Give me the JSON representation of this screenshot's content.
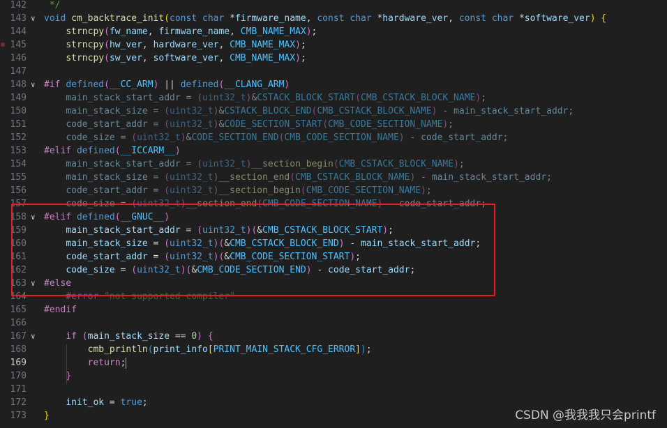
{
  "editor": {
    "lines": [
      {
        "num": "142",
        "fold": "",
        "segments": [
          [
            "cm",
            " */"
          ]
        ]
      },
      {
        "num": "143",
        "fold": "∨",
        "segments": [
          [
            "kw",
            "void "
          ],
          [
            "fn",
            "cm_backtrace_init"
          ],
          [
            "br1",
            "("
          ],
          [
            "kw",
            "const char "
          ],
          [
            "op",
            "*"
          ],
          [
            "var",
            "firmware_name"
          ],
          [
            "op",
            ", "
          ],
          [
            "kw",
            "const char "
          ],
          [
            "op",
            "*"
          ],
          [
            "var",
            "hardware_ver"
          ],
          [
            "op",
            ", "
          ],
          [
            "kw",
            "const char "
          ],
          [
            "op",
            "*"
          ],
          [
            "var",
            "software_ver"
          ],
          [
            "br1",
            ")"
          ],
          [
            "op",
            " "
          ],
          [
            "br1",
            "{"
          ]
        ]
      },
      {
        "num": "144",
        "fold": "",
        "segments": [
          [
            "op",
            "    "
          ],
          [
            "fn",
            "strncpy"
          ],
          [
            "br2",
            "("
          ],
          [
            "var",
            "fw_name"
          ],
          [
            "op",
            ", "
          ],
          [
            "var",
            "firmware_name"
          ],
          [
            "op",
            ", "
          ],
          [
            "mac",
            "CMB_NAME_MAX"
          ],
          [
            "br2",
            ")"
          ],
          [
            "op",
            ";"
          ]
        ]
      },
      {
        "num": "145",
        "fold": "",
        "breakpoint": true,
        "segments": [
          [
            "op",
            "    "
          ],
          [
            "fn",
            "strncpy"
          ],
          [
            "br2",
            "("
          ],
          [
            "var",
            "hw_ver"
          ],
          [
            "op",
            ", "
          ],
          [
            "var",
            "hardware_ver"
          ],
          [
            "op",
            ", "
          ],
          [
            "mac",
            "CMB_NAME_MAX"
          ],
          [
            "br2",
            ")"
          ],
          [
            "op",
            ";"
          ]
        ]
      },
      {
        "num": "146",
        "fold": "",
        "segments": [
          [
            "op",
            "    "
          ],
          [
            "fn",
            "strncpy"
          ],
          [
            "br2",
            "("
          ],
          [
            "var",
            "sw_ver"
          ],
          [
            "op",
            ", "
          ],
          [
            "var",
            "software_ver"
          ],
          [
            "op",
            ", "
          ],
          [
            "mac",
            "CMB_NAME_MAX"
          ],
          [
            "br2",
            ")"
          ],
          [
            "op",
            ";"
          ]
        ]
      },
      {
        "num": "147",
        "fold": "",
        "segments": []
      },
      {
        "num": "148",
        "fold": "∨",
        "segments": [
          [
            "pp",
            "#if "
          ],
          [
            "kw",
            "defined"
          ],
          [
            "br2",
            "("
          ],
          [
            "mac",
            "__CC_ARM"
          ],
          [
            "br2",
            ")"
          ],
          [
            "op",
            " || "
          ],
          [
            "kw",
            "defined"
          ],
          [
            "br2",
            "("
          ],
          [
            "mac",
            "__CLANG_ARM"
          ],
          [
            "br2",
            ")"
          ]
        ]
      },
      {
        "num": "149",
        "fold": "",
        "dim": true,
        "segments": [
          [
            "op",
            "    "
          ],
          [
            "var",
            "main_stack_start_addr"
          ],
          [
            "op",
            " = "
          ],
          [
            "br2",
            "("
          ],
          [
            "kw",
            "uint32_t"
          ],
          [
            "br2",
            ")"
          ],
          [
            "op",
            "&"
          ],
          [
            "mac",
            "CSTACK_BLOCK_START"
          ],
          [
            "br2",
            "("
          ],
          [
            "mac",
            "CMB_CSTACK_BLOCK_NAME"
          ],
          [
            "br2",
            ")"
          ],
          [
            "op",
            ";"
          ]
        ]
      },
      {
        "num": "150",
        "fold": "",
        "dim": true,
        "segments": [
          [
            "op",
            "    "
          ],
          [
            "var",
            "main_stack_size"
          ],
          [
            "op",
            " = "
          ],
          [
            "br2",
            "("
          ],
          [
            "kw",
            "uint32_t"
          ],
          [
            "br2",
            ")"
          ],
          [
            "op",
            "&"
          ],
          [
            "mac",
            "CSTACK_BLOCK_END"
          ],
          [
            "br2",
            "("
          ],
          [
            "mac",
            "CMB_CSTACK_BLOCK_NAME"
          ],
          [
            "br2",
            ")"
          ],
          [
            "op",
            " - "
          ],
          [
            "var",
            "main_stack_start_addr"
          ],
          [
            "op",
            ";"
          ]
        ]
      },
      {
        "num": "151",
        "fold": "",
        "dim": true,
        "segments": [
          [
            "op",
            "    "
          ],
          [
            "var",
            "code_start_addr"
          ],
          [
            "op",
            " = "
          ],
          [
            "br2",
            "("
          ],
          [
            "kw",
            "uint32_t"
          ],
          [
            "br2",
            ")"
          ],
          [
            "op",
            "&"
          ],
          [
            "mac",
            "CODE_SECTION_START"
          ],
          [
            "br2",
            "("
          ],
          [
            "mac",
            "CMB_CODE_SECTION_NAME"
          ],
          [
            "br2",
            ")"
          ],
          [
            "op",
            ";"
          ]
        ]
      },
      {
        "num": "152",
        "fold": "",
        "dim": true,
        "segments": [
          [
            "op",
            "    "
          ],
          [
            "var",
            "code_size"
          ],
          [
            "op",
            " = "
          ],
          [
            "br2",
            "("
          ],
          [
            "kw",
            "uint32_t"
          ],
          [
            "br2",
            ")"
          ],
          [
            "op",
            "&"
          ],
          [
            "mac",
            "CODE_SECTION_END"
          ],
          [
            "br2",
            "("
          ],
          [
            "mac",
            "CMB_CODE_SECTION_NAME"
          ],
          [
            "br2",
            ")"
          ],
          [
            "op",
            " - "
          ],
          [
            "var",
            "code_start_addr"
          ],
          [
            "op",
            ";"
          ]
        ]
      },
      {
        "num": "153",
        "fold": "",
        "segments": [
          [
            "pp",
            "#elif "
          ],
          [
            "kw",
            "defined"
          ],
          [
            "br2",
            "("
          ],
          [
            "mac",
            "__ICCARM__"
          ],
          [
            "br2",
            ")"
          ]
        ]
      },
      {
        "num": "154",
        "fold": "",
        "dim": true,
        "segments": [
          [
            "op",
            "    "
          ],
          [
            "var",
            "main_stack_start_addr"
          ],
          [
            "op",
            " = "
          ],
          [
            "br2",
            "("
          ],
          [
            "kw",
            "uint32_t"
          ],
          [
            "br2",
            ")"
          ],
          [
            "fn",
            "__section_begin"
          ],
          [
            "br2",
            "("
          ],
          [
            "mac",
            "CMB_CSTACK_BLOCK_NAME"
          ],
          [
            "br2",
            ")"
          ],
          [
            "op",
            ";"
          ]
        ]
      },
      {
        "num": "155",
        "fold": "",
        "dim": true,
        "segments": [
          [
            "op",
            "    "
          ],
          [
            "var",
            "main_stack_size"
          ],
          [
            "op",
            " = "
          ],
          [
            "br2",
            "("
          ],
          [
            "kw",
            "uint32_t"
          ],
          [
            "br2",
            ")"
          ],
          [
            "fn",
            "__section_end"
          ],
          [
            "br2",
            "("
          ],
          [
            "mac",
            "CMB_CSTACK_BLOCK_NAME"
          ],
          [
            "br2",
            ")"
          ],
          [
            "op",
            " - "
          ],
          [
            "var",
            "main_stack_start_addr"
          ],
          [
            "op",
            ";"
          ]
        ]
      },
      {
        "num": "156",
        "fold": "",
        "dim": true,
        "segments": [
          [
            "op",
            "    "
          ],
          [
            "var",
            "code_start_addr"
          ],
          [
            "op",
            " = "
          ],
          [
            "br2",
            "("
          ],
          [
            "kw",
            "uint32_t"
          ],
          [
            "br2",
            ")"
          ],
          [
            "fn",
            "__section_begin"
          ],
          [
            "br2",
            "("
          ],
          [
            "mac",
            "CMB_CODE_SECTION_NAME"
          ],
          [
            "br2",
            ")"
          ],
          [
            "op",
            ";"
          ]
        ]
      },
      {
        "num": "157",
        "fold": "",
        "dim": true,
        "segments": [
          [
            "op",
            "    "
          ],
          [
            "var",
            "code_size"
          ],
          [
            "op",
            " = "
          ],
          [
            "br2",
            "("
          ],
          [
            "kw",
            "uint32_t"
          ],
          [
            "br2",
            ")"
          ],
          [
            "fn",
            "__section_end"
          ],
          [
            "br2",
            "("
          ],
          [
            "mac",
            "CMB_CODE_SECTION_NAME"
          ],
          [
            "br2",
            ")"
          ],
          [
            "op",
            " - "
          ],
          [
            "var",
            "code_start_addr"
          ],
          [
            "op",
            ";"
          ]
        ]
      },
      {
        "num": "158",
        "fold": "∨",
        "segments": [
          [
            "pp",
            "#elif "
          ],
          [
            "kw",
            "defined"
          ],
          [
            "br2",
            "("
          ],
          [
            "mac",
            "__GNUC__"
          ],
          [
            "br2",
            ")"
          ]
        ]
      },
      {
        "num": "159",
        "fold": "",
        "segments": [
          [
            "op",
            "    "
          ],
          [
            "var",
            "main_stack_start_addr"
          ],
          [
            "op",
            " = "
          ],
          [
            "br2",
            "("
          ],
          [
            "kw",
            "uint32_t"
          ],
          [
            "br2",
            ")"
          ],
          [
            "br2",
            "("
          ],
          [
            "op",
            "&"
          ],
          [
            "mac",
            "CMB_CSTACK_BLOCK_START"
          ],
          [
            "br2",
            ")"
          ],
          [
            "op",
            ";"
          ]
        ]
      },
      {
        "num": "160",
        "fold": "",
        "segments": [
          [
            "op",
            "    "
          ],
          [
            "var",
            "main_stack_size"
          ],
          [
            "op",
            " = "
          ],
          [
            "br2",
            "("
          ],
          [
            "kw",
            "uint32_t"
          ],
          [
            "br2",
            ")"
          ],
          [
            "br2",
            "("
          ],
          [
            "op",
            "&"
          ],
          [
            "mac",
            "CMB_CSTACK_BLOCK_END"
          ],
          [
            "br2",
            ")"
          ],
          [
            "op",
            " - "
          ],
          [
            "var",
            "main_stack_start_addr"
          ],
          [
            "op",
            ";"
          ]
        ]
      },
      {
        "num": "161",
        "fold": "",
        "segments": [
          [
            "op",
            "    "
          ],
          [
            "var",
            "code_start_addr"
          ],
          [
            "op",
            " = "
          ],
          [
            "br2",
            "("
          ],
          [
            "kw",
            "uint32_t"
          ],
          [
            "br2",
            ")"
          ],
          [
            "br2",
            "("
          ],
          [
            "op",
            "&"
          ],
          [
            "mac",
            "CMB_CODE_SECTION_START"
          ],
          [
            "br2",
            ")"
          ],
          [
            "op",
            ";"
          ]
        ]
      },
      {
        "num": "162",
        "fold": "",
        "segments": [
          [
            "op",
            "    "
          ],
          [
            "var",
            "code_size"
          ],
          [
            "op",
            " = "
          ],
          [
            "br2",
            "("
          ],
          [
            "kw",
            "uint32_t"
          ],
          [
            "br2",
            ")"
          ],
          [
            "br2",
            "("
          ],
          [
            "op",
            "&"
          ],
          [
            "mac",
            "CMB_CODE_SECTION_END"
          ],
          [
            "br2",
            ")"
          ],
          [
            "op",
            " - "
          ],
          [
            "var",
            "code_start_addr"
          ],
          [
            "op",
            ";"
          ]
        ]
      },
      {
        "num": "163",
        "fold": "∨",
        "segments": [
          [
            "pp",
            "#else"
          ]
        ]
      },
      {
        "num": "164",
        "fold": "",
        "dim": true,
        "segments": [
          [
            "op",
            "    "
          ],
          [
            "pp",
            "#error "
          ],
          [
            "cm",
            "\"not supported compiler\""
          ]
        ]
      },
      {
        "num": "165",
        "fold": "",
        "segments": [
          [
            "pp",
            "#endif"
          ]
        ]
      },
      {
        "num": "166",
        "fold": "",
        "segments": []
      },
      {
        "num": "167",
        "fold": "∨",
        "segments": [
          [
            "op",
            "    "
          ],
          [
            "pp",
            "if "
          ],
          [
            "br2",
            "("
          ],
          [
            "var",
            "main_stack_size"
          ],
          [
            "op",
            " == "
          ],
          [
            "num",
            "0"
          ],
          [
            "br2",
            ")"
          ],
          [
            "op",
            " "
          ],
          [
            "br2",
            "{"
          ]
        ]
      },
      {
        "num": "168",
        "fold": "",
        "segments": [
          [
            "op",
            "        "
          ],
          [
            "fn",
            "cmb_println"
          ],
          [
            "br3",
            "("
          ],
          [
            "var",
            "print_info"
          ],
          [
            "br1",
            "["
          ],
          [
            "mac",
            "PRINT_MAIN_STACK_CFG_ERROR"
          ],
          [
            "br1",
            "]"
          ],
          [
            "br3",
            ")"
          ],
          [
            "op",
            ";"
          ]
        ]
      },
      {
        "num": "169",
        "fold": "",
        "active": true,
        "cursor": true,
        "segments": [
          [
            "op",
            "        "
          ],
          [
            "pp",
            "return"
          ],
          [
            "op",
            ";"
          ]
        ]
      },
      {
        "num": "170",
        "fold": "",
        "segments": [
          [
            "op",
            "    "
          ],
          [
            "br2",
            "}"
          ]
        ]
      },
      {
        "num": "171",
        "fold": "",
        "segments": []
      },
      {
        "num": "172",
        "fold": "",
        "segments": [
          [
            "op",
            "    "
          ],
          [
            "var",
            "init_ok"
          ],
          [
            "op",
            " = "
          ],
          [
            "kw",
            "true"
          ],
          [
            "op",
            ";"
          ]
        ]
      },
      {
        "num": "173",
        "fold": "",
        "segments": [
          [
            "br1",
            "}"
          ]
        ]
      }
    ]
  },
  "watermark": "CSDN @我我我只会printf",
  "colors": {
    "highlight_box": "#e51e25",
    "background": "#1f1f1f"
  }
}
